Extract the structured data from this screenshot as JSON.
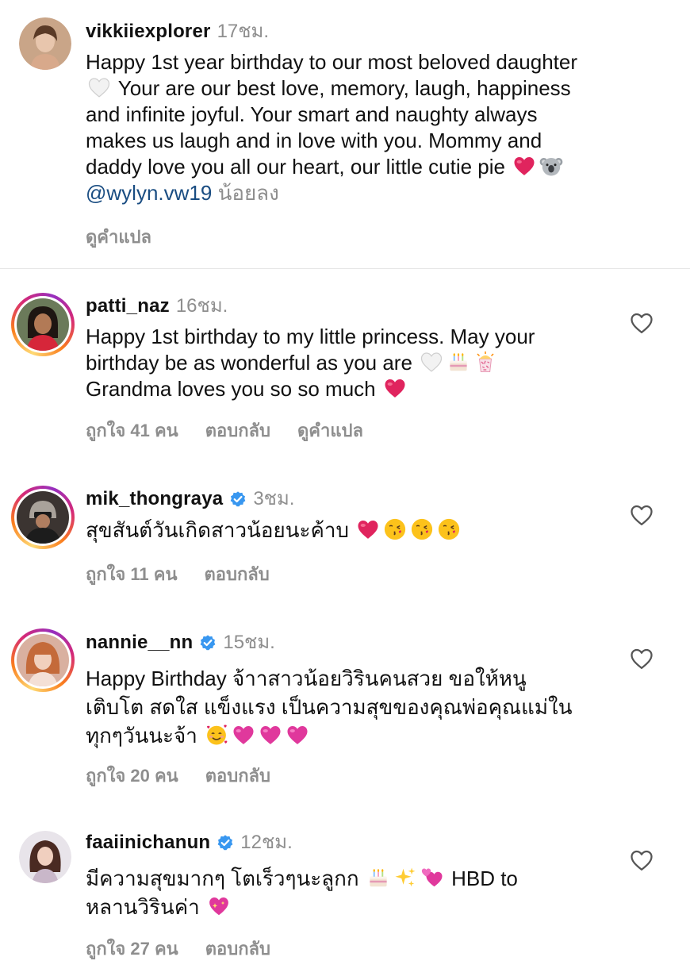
{
  "comments": [
    {
      "username": "vikkiiexplorer",
      "time": "17ชม.",
      "text": [
        "Happy 1st year birthday to our most beloved daughter",
        "Your are our best love, memory, laugh, happiness",
        "and infinite joyful. Your smart and naughty always",
        "makes us laugh and in love with you. Mommy and",
        "daddy love you all our heart, our little cutie pie"
      ],
      "mention": "@wylyn.vw19",
      "less": "น้อยลง",
      "translate": "ดูคำแปล"
    },
    {
      "username": "patti_naz",
      "time": "16ชม.",
      "text": [
        "Happy 1st birthday to my little princess. May your",
        "birthday be as wonderful as you are",
        "Grandma loves you so so much"
      ],
      "likes": "ถูกใจ 41 คน",
      "reply": "ตอบกลับ",
      "translate": "ดูคำแปล"
    },
    {
      "username": "mik_thongraya",
      "verified": true,
      "time": "3ชม.",
      "text": [
        "สุขสันต์วันเกิดสาวน้อยนะค้าบ"
      ],
      "likes": "ถูกใจ 11 คน",
      "reply": "ตอบกลับ"
    },
    {
      "username": "nannie__nn",
      "verified": true,
      "time": "15ชม.",
      "text": [
        "Happy Birthday จ้าาสาวน้อยวิรินคนสวย ขอให้หนู",
        "เติบโต สดใส  แข็งแรง เป็นความสุขของคุณพ่อคุณแม่ใน",
        "ทุกๆวันนะจ้า"
      ],
      "likes": "ถูกใจ 20 คน",
      "reply": "ตอบกลับ"
    },
    {
      "username": "faaiinichanun",
      "verified": true,
      "time": "12ชม.",
      "text": [
        "มีความสุขมากๆ โตเร็วๆนะลูกก",
        "HBD to",
        "หลานวิรินค่า"
      ],
      "likes": "ถูกใจ 27 คน",
      "reply": "ตอบกลับ"
    }
  ],
  "icons": {
    "like": "heart-outline-icon",
    "verified": "verified-badge-icon"
  },
  "colors": {
    "username": "#111111",
    "meta": "#8e8e8e",
    "mention": "#1a4d82",
    "verified": "#3897f0",
    "red_heart": "#e0245e",
    "pink_heart": "#e0389c"
  }
}
